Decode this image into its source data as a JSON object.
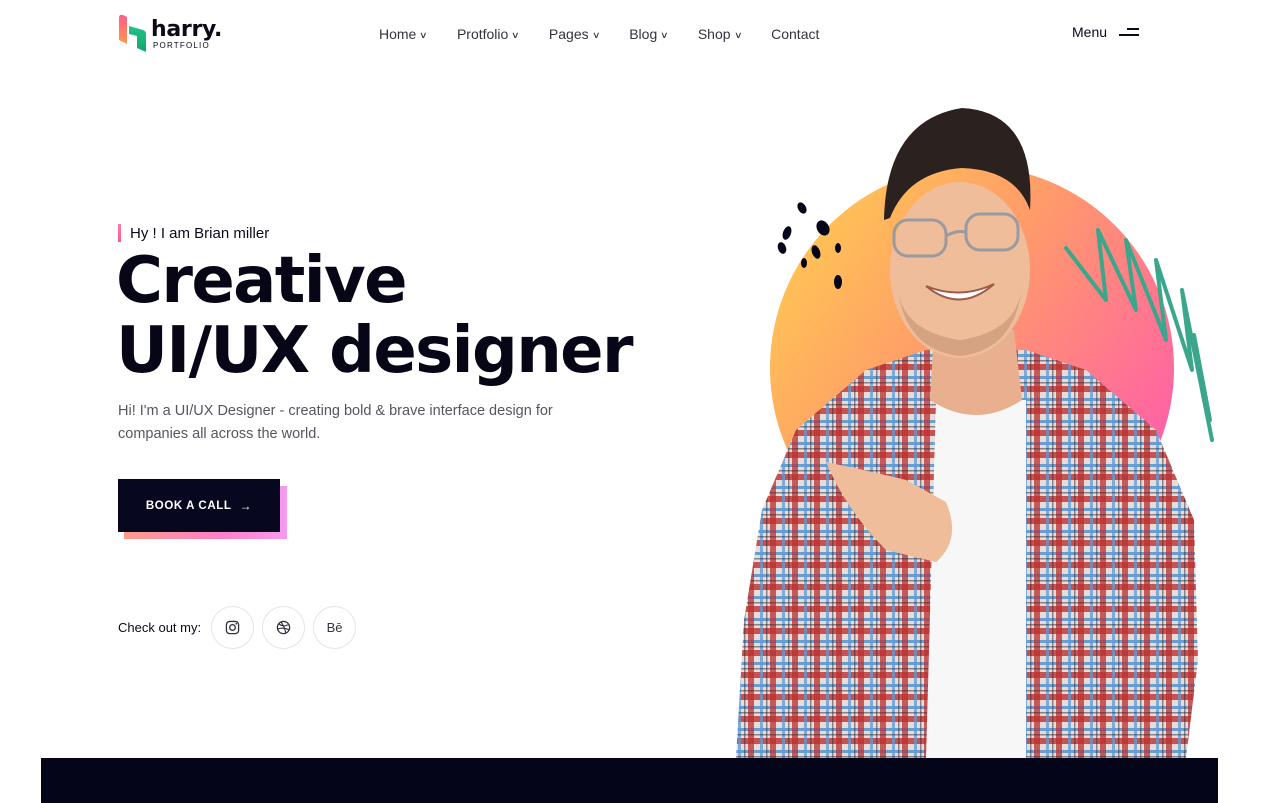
{
  "brand": {
    "name": "harry.",
    "subtitle": "PORTFOLIO"
  },
  "nav": [
    {
      "label": "Home",
      "has_dropdown": true
    },
    {
      "label": "Protfolio",
      "has_dropdown": true
    },
    {
      "label": "Pages",
      "has_dropdown": true
    },
    {
      "label": "Blog",
      "has_dropdown": true
    },
    {
      "label": "Shop",
      "has_dropdown": true
    },
    {
      "label": "Contact",
      "has_dropdown": false
    }
  ],
  "menu": {
    "label": "Menu",
    "icon": "hamburger-icon"
  },
  "hero": {
    "eyebrow": "Hy ! I am Brian miller",
    "headline_line1": "Creative",
    "headline_line2": "UI/UX designer",
    "lead": "Hi! I'm a UI/UX Designer - creating bold & brave interface design for companies all across the world.",
    "cta_label": "BOOK A CALL",
    "cta_icon": "arrow-right-icon"
  },
  "social": {
    "label": "Check out my:",
    "items": [
      {
        "icon": "instagram-icon"
      },
      {
        "icon": "dribbble-icon"
      },
      {
        "icon": "behance-icon",
        "text": "Bē"
      }
    ]
  },
  "colors": {
    "dark": "#060617",
    "accent_pink": "#ff6fb0",
    "accent_orange": "#ffc85a",
    "accent_green": "#3aa68c"
  }
}
